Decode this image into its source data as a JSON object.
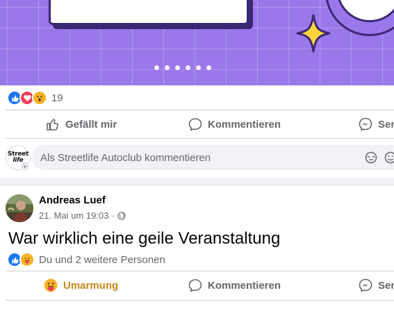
{
  "post1": {
    "reaction_icons": [
      "like-icon",
      "love-icon",
      "wow-icon"
    ],
    "reaction_count": "19",
    "carousel_dot_count": 6,
    "actions": {
      "like": "Gefällt mir",
      "comment": "Kommentieren",
      "send": "Senden"
    },
    "comment_box": {
      "avatar_line1": "Street",
      "avatar_line2": "life",
      "placeholder": "Als Streetlife Autoclub kommentieren"
    }
  },
  "post2": {
    "author": "Andreas Luef",
    "timestamp": "21. Mai um 19:03",
    "meta_separator": "·",
    "text": "War wirklich eine geile Veranstaltung",
    "reaction_icons": [
      "like-icon",
      "care-icon"
    ],
    "reactors": "Du und 2 weitere Personen",
    "actions": {
      "reaction": "Umarmung",
      "comment": "Kommentieren",
      "send": "Senden"
    }
  },
  "colors": {
    "facebook_blue": "#1877f2",
    "love_red": "#f33e58",
    "care_yellow": "#f7b125",
    "umarmung_text": "#c8871b",
    "banner_purple": "#9a78ea",
    "muted_text": "#65676b"
  }
}
